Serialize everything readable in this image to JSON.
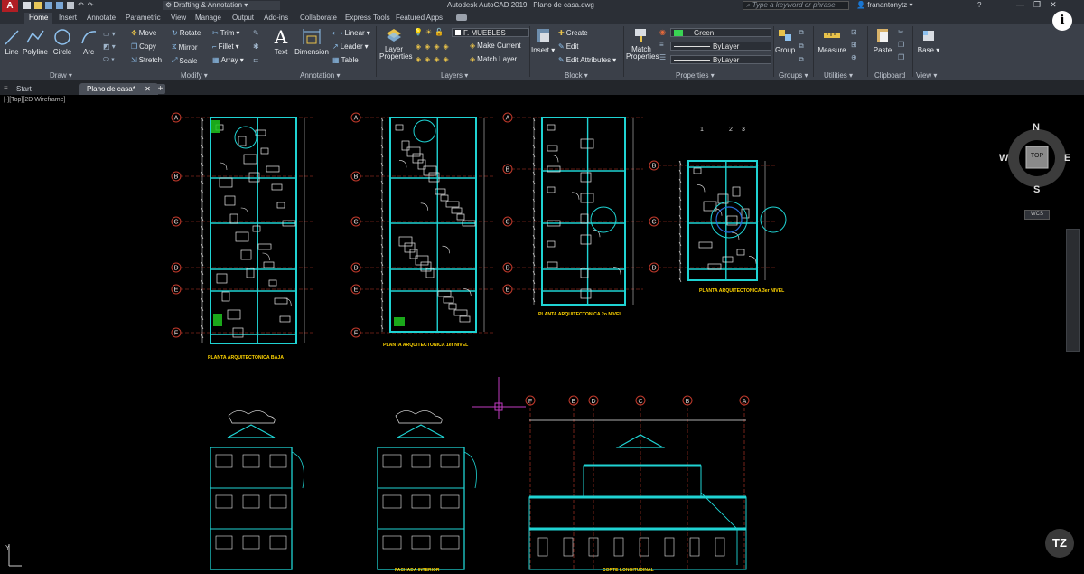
{
  "app": {
    "title": "Autodesk AutoCAD 2019",
    "document_title": "Plano de casa.dwg",
    "workspace": "Drafting & Annotation",
    "search_placeholder": "Type a keyword or phrase",
    "user": "franantonytz"
  },
  "ribbon_tabs": [
    "Home",
    "Insert",
    "Annotate",
    "Parametric",
    "View",
    "Manage",
    "Output",
    "Add-ins",
    "Collaborate",
    "Express Tools",
    "Featured Apps"
  ],
  "draw": {
    "panel": "Draw",
    "line": "Line",
    "polyline": "Polyline",
    "circle": "Circle",
    "arc": "Arc"
  },
  "modify": {
    "panel": "Modify",
    "move": "Move",
    "rotate": "Rotate",
    "trim": "Trim",
    "copy": "Copy",
    "mirror": "Mirror",
    "fillet": "Fillet",
    "stretch": "Stretch",
    "scale": "Scale",
    "array": "Array"
  },
  "annotation": {
    "panel": "Annotation",
    "text": "Text",
    "dimension": "Dimension",
    "linear": "Linear",
    "leader": "Leader",
    "table": "Table"
  },
  "layers": {
    "panel": "Layers",
    "layer_properties": "Layer Properties",
    "current_layer": "F. MUEBLES",
    "make_current": "Make Current",
    "match_layer": "Match Layer"
  },
  "block": {
    "panel": "Block",
    "insert": "Insert",
    "create": "Create",
    "edit": "Edit",
    "edit_attributes": "Edit Attributes"
  },
  "properties": {
    "panel": "Properties",
    "match_properties": "Match Properties",
    "color": "Green",
    "linetype": "ByLayer",
    "lineweight": "ByLayer",
    "color_hex": "#39d353"
  },
  "groups": {
    "panel": "Groups",
    "group": "Group"
  },
  "utilities": {
    "panel": "Utilities",
    "measure": "Measure"
  },
  "clipboard": {
    "panel": "Clipboard",
    "paste": "Paste"
  },
  "view": {
    "panel": "View",
    "base": "Base"
  },
  "doc_tabs": [
    "Start",
    "Plano de casa*"
  ],
  "viewcube": {
    "n": "N",
    "s": "S",
    "e": "E",
    "w": "W",
    "top": "TOP",
    "wcs": "WCS"
  },
  "drawing": {
    "plan1_title": "PLANTA ARQUITECTONICA BAJA",
    "plan2_title": "PLANTA ARQUITECTONICA 1er NIVEL",
    "plan3_title": "PLANTA ARQUITECTONICA 2o NIVEL",
    "plan4_title": "PLANTA ARQUITECTONICA 3er NIVEL",
    "facade_title": "FACHADA INTERIOR",
    "section_title": "CORTE LONGITUDINAL",
    "grid_rows": [
      "A",
      "B",
      "C",
      "D",
      "E",
      "F"
    ],
    "grid_cols": [
      "1",
      "2",
      "3"
    ],
    "section_axes": [
      "F",
      "E",
      "D",
      "C",
      "B",
      "A"
    ]
  },
  "watermark": "TZ",
  "colors": {
    "wall": "#1fd3d3",
    "dim": "#e8e8e8",
    "axis_line": "#c0392b",
    "title_text": "#ffd400",
    "furniture": "#e8e8e8",
    "accent_green": "#1ec51e",
    "crosshair": "#c03bc0"
  }
}
